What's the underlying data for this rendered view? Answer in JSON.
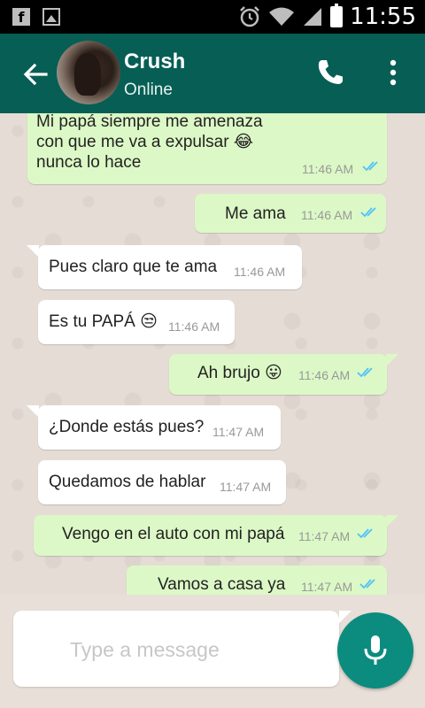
{
  "status_bar": {
    "time": "11:55",
    "icons": [
      "facebook-icon",
      "gallery-icon",
      "alarm-icon",
      "wifi-icon",
      "signal-icon",
      "battery-icon"
    ]
  },
  "header": {
    "contact_name": "Crush",
    "contact_status": "Online",
    "icons": [
      "back-arrow-icon",
      "phone-icon",
      "more-vert-icon"
    ]
  },
  "messages": [
    {
      "direction": "out",
      "lines": [
        "Mi papá siempre me amenaza",
        "con que me va a expulsar 😂",
        "nunca lo hace"
      ],
      "time": "11:46 AM",
      "read": true
    },
    {
      "direction": "out",
      "text": "Me ama",
      "time": "11:46 AM",
      "read": true
    },
    {
      "direction": "in",
      "text": "Pues claro que te ama",
      "time": "11:46 AM"
    },
    {
      "direction": "in",
      "text": "Es tu PAPÁ 😒",
      "time": "11:46 AM"
    },
    {
      "direction": "out",
      "text": "Ah brujo 😛",
      "time": "11:46 AM",
      "read": true
    },
    {
      "direction": "in",
      "text": "¿Donde estás pues?",
      "time": "11:47 AM"
    },
    {
      "direction": "in",
      "text": "Quedamos de hablar",
      "time": "11:47 AM"
    },
    {
      "direction": "out",
      "text": "Vengo en el auto con mi papá",
      "time": "11:47 AM",
      "read": true
    },
    {
      "direction": "out",
      "text": "Vamos a casa ya",
      "time": "11:47 AM",
      "read": true
    }
  ],
  "composer": {
    "placeholder": "Type a message",
    "value": ""
  },
  "colors": {
    "header": "#075e55",
    "outgoing_bubble": "#dcf8c6",
    "incoming_bubble": "#ffffff",
    "read_ticks": "#4fc3f7",
    "mic_button": "#0b8c7f"
  }
}
